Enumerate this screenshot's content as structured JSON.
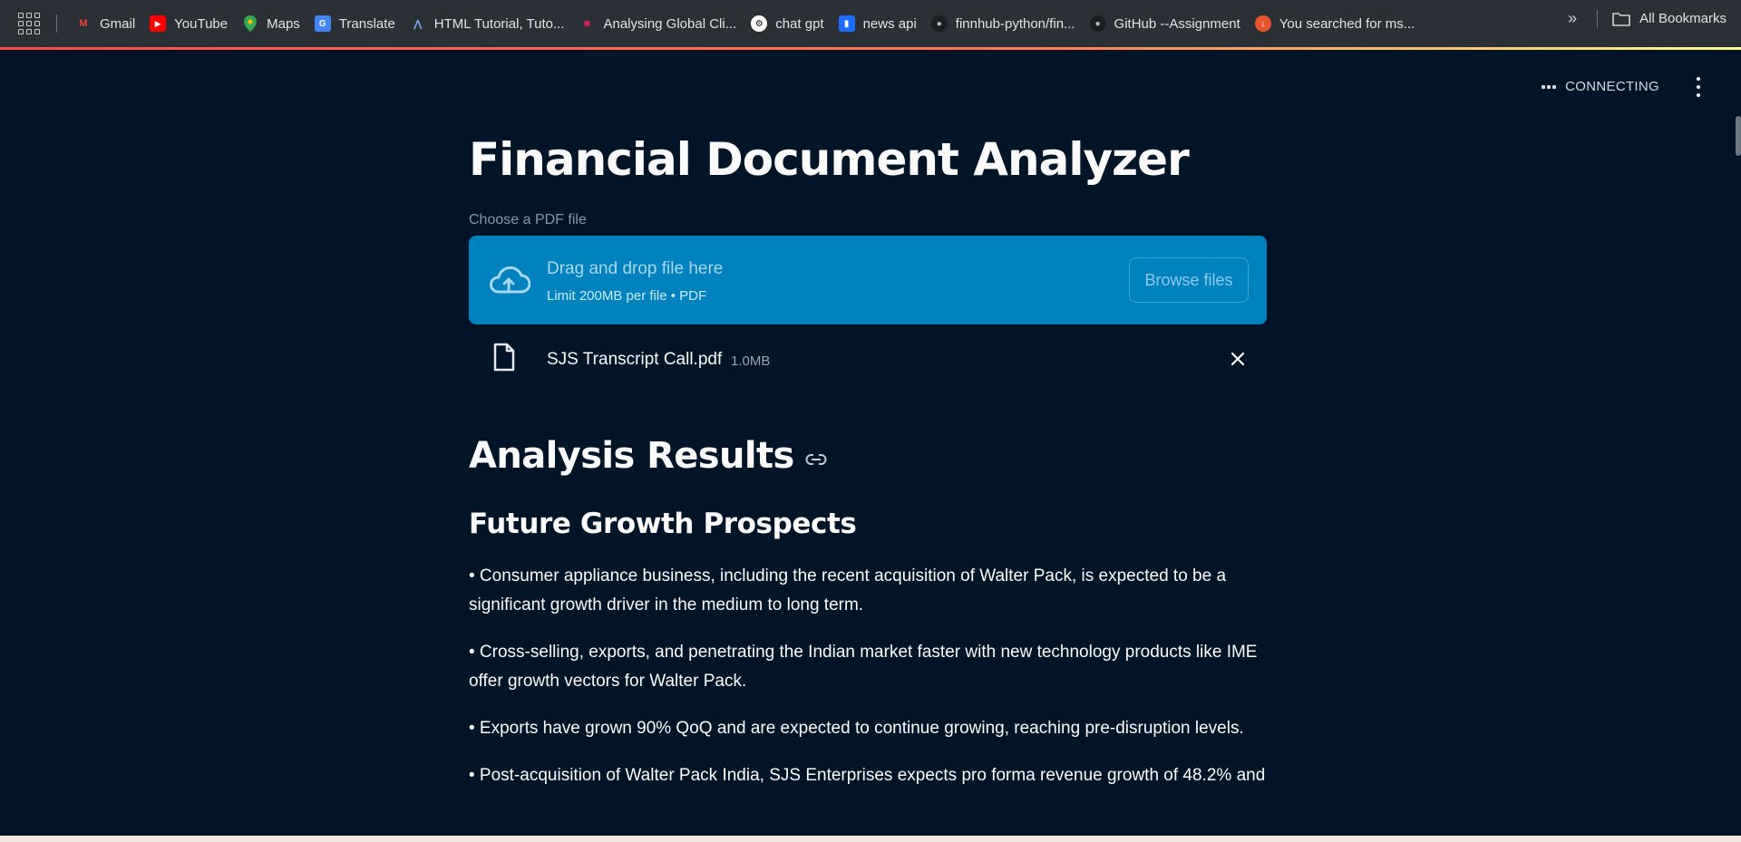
{
  "bookmarks": {
    "items": [
      {
        "label": "Gmail",
        "icon": "gmail-icon"
      },
      {
        "label": "YouTube",
        "icon": "youtube-icon"
      },
      {
        "label": "Maps",
        "icon": "maps-icon"
      },
      {
        "label": "Translate",
        "icon": "translate-icon"
      },
      {
        "label": "HTML Tutorial, Tuto...",
        "icon": "w3schools-icon"
      },
      {
        "label": "Analysing Global Cli...",
        "icon": "slack-icon"
      },
      {
        "label": "chat gpt",
        "icon": "chatgpt-icon"
      },
      {
        "label": "news api",
        "icon": "newsapi-icon"
      },
      {
        "label": "finnhub-python/fin...",
        "icon": "github-icon"
      },
      {
        "label": "GitHub --Assignment",
        "icon": "github-icon"
      },
      {
        "label": "You searched for ms...",
        "icon": "download-icon"
      }
    ],
    "all_bookmarks": "All Bookmarks"
  },
  "status": {
    "text": "CONNECTING"
  },
  "app": {
    "title": "Financial Document Analyzer",
    "uploader": {
      "label": "Choose a PDF file",
      "drop_title": "Drag and drop file here",
      "drop_subtitle": "Limit 200MB per file • PDF",
      "browse_label": "Browse files"
    },
    "file": {
      "name": "SJS Transcript Call.pdf",
      "size": "1.0MB"
    },
    "results_heading": "Analysis Results",
    "section_heading": "Future Growth Prospects",
    "bullets": [
      "• Consumer appliance business, including the recent acquisition of Walter Pack, is expected to be a significant growth driver in the medium to long term.",
      "• Cross-selling, exports, and penetrating the Indian market faster with new technology products like IME offer growth vectors for Walter Pack.",
      "• Exports have grown 90% QoQ and are expected to continue growing, reaching pre-disruption levels.",
      "• Post-acquisition of Walter Pack India, SJS Enterprises expects pro forma revenue growth of 48.2% and"
    ]
  },
  "colors": {
    "app_bg": "#021428",
    "dropzone": "#0082be",
    "chrome_bar": "#2b3036",
    "loading_gradient_start": "#ff4b4b"
  }
}
